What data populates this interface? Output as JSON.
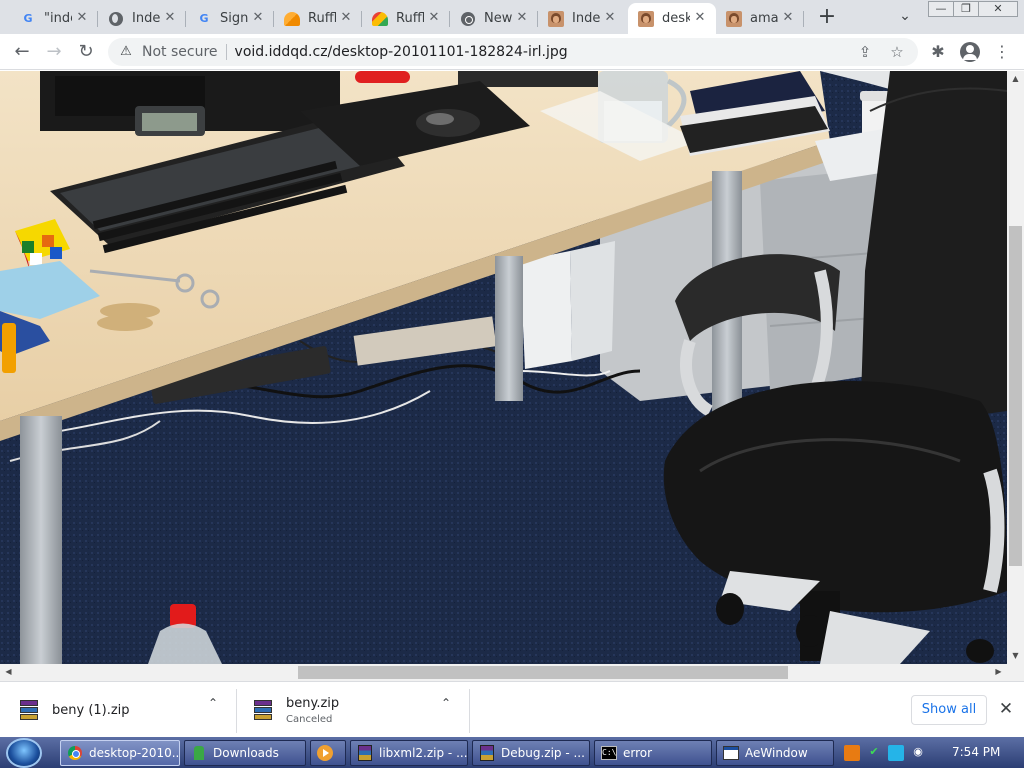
{
  "browser": {
    "tabs": [
      {
        "title": "\"index",
        "icon": "google-icon",
        "active": false
      },
      {
        "title": "Index",
        "icon": "globe-icon",
        "active": false
      },
      {
        "title": "Sign",
        "icon": "google-icon",
        "active": false
      },
      {
        "title": "Ruffle",
        "icon": "ruffle-icon",
        "active": false
      },
      {
        "title": "Ruffle",
        "icon": "ruffle-colored-icon",
        "active": false
      },
      {
        "title": "New",
        "icon": "chrome-icon",
        "active": false
      },
      {
        "title": "Index",
        "icon": "face-icon",
        "active": false
      },
      {
        "title": "desk",
        "icon": "face-icon",
        "active": true
      },
      {
        "title": "ama",
        "icon": "face-icon",
        "active": false
      }
    ],
    "new_tab_glyph": "+",
    "tab_search_glyph": "⌄",
    "window_buttons": {
      "minimize": "—",
      "restore": "❐",
      "close": "✕"
    },
    "toolbar": {
      "back_glyph": "←",
      "forward_glyph": "→",
      "reload_glyph": "↻",
      "security_label": "Not secure",
      "url": "void.iddqd.cz/desktop-20101101-182824-irl.jpg",
      "share_glyph": "⇪",
      "star_glyph": "☆",
      "extensions_glyph": "✱",
      "menu_glyph": "⋮"
    }
  },
  "content": {
    "image_description_alt": "desktop-20101101-182824-irl.jpg"
  },
  "downloads": {
    "items": [
      {
        "filename": "beny (1).zip",
        "status": ""
      },
      {
        "filename": "beny.zip",
        "status": "Canceled"
      }
    ],
    "show_all_label": "Show all",
    "close_glyph": "✕",
    "chevron_glyph": "⌃"
  },
  "taskbar": {
    "tasks": [
      {
        "label": "desktop-2010...",
        "icon": "chrome-icon",
        "active": true
      },
      {
        "label": "Downloads",
        "icon": "download-icon",
        "active": false
      },
      {
        "label": "",
        "icon": "media-player-icon",
        "active": false
      },
      {
        "label": "libxml2.zip - ...",
        "icon": "winrar-icon",
        "active": false
      },
      {
        "label": "Debug.zip - ...",
        "icon": "winrar-icon",
        "active": false
      },
      {
        "label": "error",
        "icon": "cmd-icon",
        "active": false
      },
      {
        "label": "AeWindow",
        "icon": "app-window-icon",
        "active": false
      }
    ],
    "clock": "7:54 PM"
  }
}
